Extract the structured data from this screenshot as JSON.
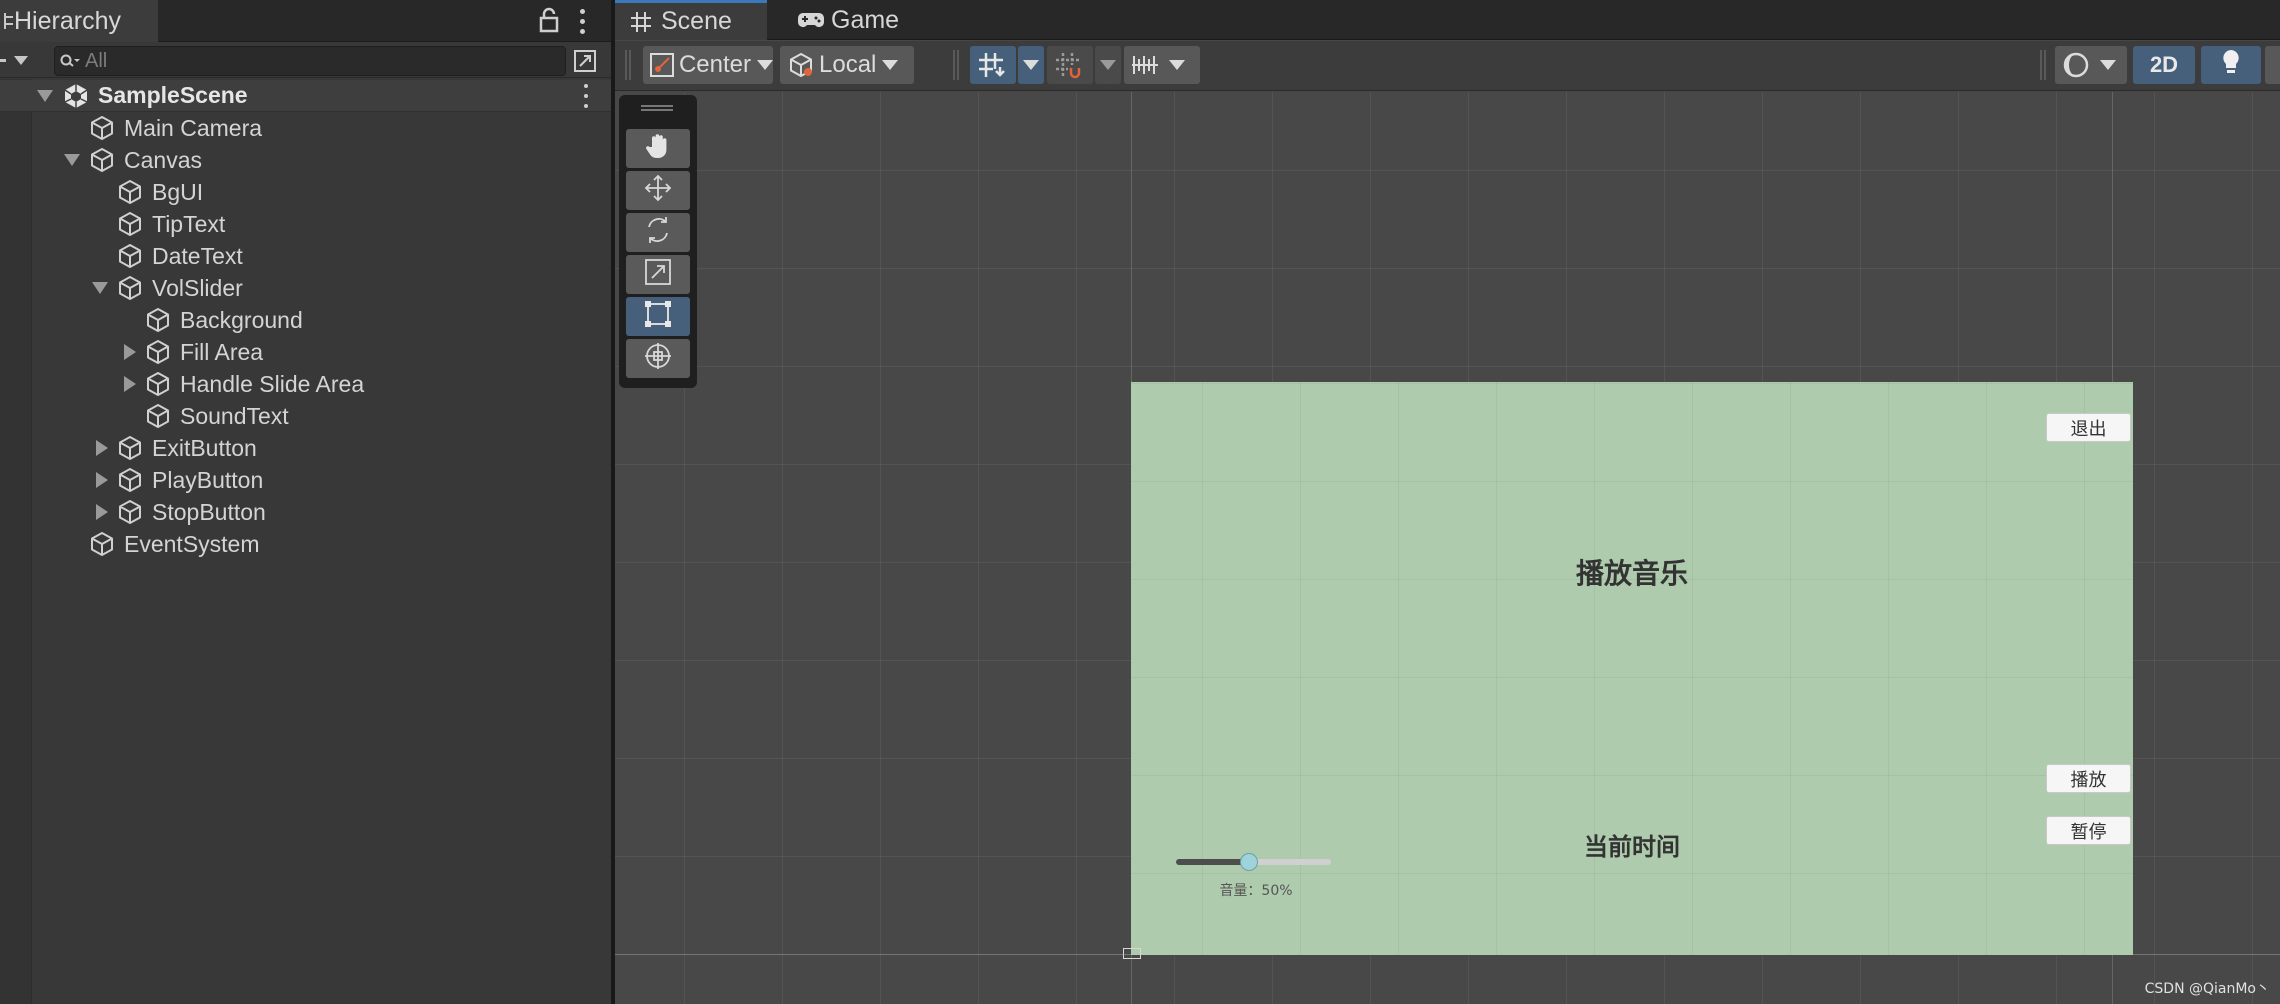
{
  "hierarchy": {
    "tab_label": "Hierarchy",
    "search_placeholder": "All",
    "scene_name": "SampleScene",
    "items": {
      "main_camera": "Main Camera",
      "canvas": "Canvas",
      "bgui": "BgUI",
      "tiptext": "TipText",
      "datetext": "DateText",
      "volslider": "VolSlider",
      "background": "Background",
      "fill_area": "Fill Area",
      "handle_slide_area": "Handle Slide Area",
      "soundtext": "SoundText",
      "exitbutton": "ExitButton",
      "playbutton": "PlayButton",
      "stopbutton": "StopButton",
      "eventsystem": "EventSystem"
    }
  },
  "tabs": {
    "scene": "Scene",
    "game": "Game"
  },
  "toolbar": {
    "pivot_mode": "Center",
    "pivot_rotation": "Local",
    "mode_2d": "2D"
  },
  "canvas_ui": {
    "tip_text": "播放音乐",
    "date_text": "当前时间",
    "exit_button": "退出",
    "play_button": "播放",
    "stop_button": "暂停",
    "sound_text": "音量：50%",
    "volume_value": 0.47
  },
  "watermark": "CSDN @QianMo丶",
  "colors": {
    "canvas_bg": "#afcbad",
    "active_tool": "#46607c",
    "tab_accent": "#3a79bb"
  }
}
